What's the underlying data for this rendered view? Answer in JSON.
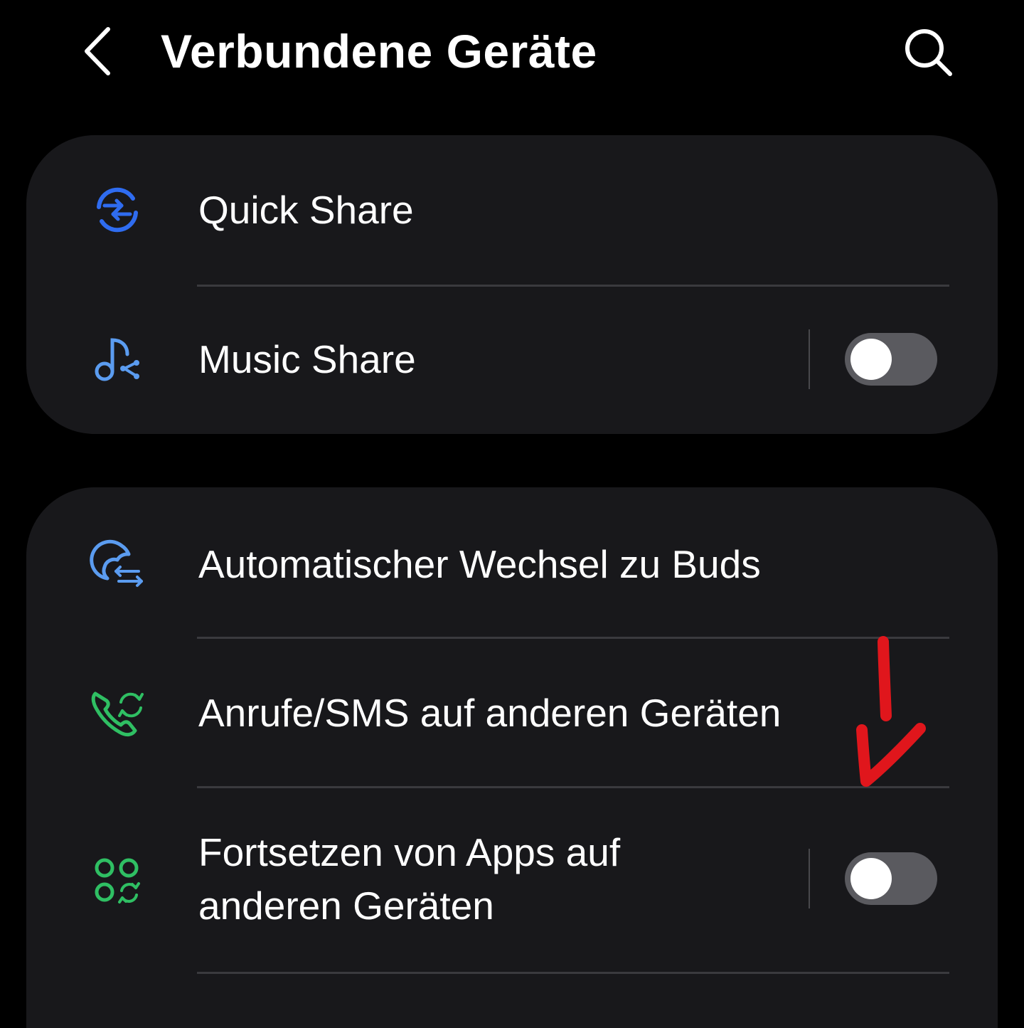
{
  "header": {
    "title": "Verbundene Geräte",
    "back_icon": "chevron-left-icon",
    "search_icon": "search-icon"
  },
  "colors": {
    "background": "#000000",
    "card": "#18181b",
    "text": "#ffffff",
    "divider": "#3a3a3e",
    "toggle_off_track": "#5a5a5f",
    "toggle_knob": "#ffffff",
    "icon_blue": "#2f6cf0",
    "icon_light_blue": "#5b9cf0",
    "icon_green": "#2fbf63",
    "annotation_red": "#e0161c"
  },
  "groups": [
    {
      "items": [
        {
          "label": "Quick Share",
          "icon": "quick-share-icon"
        },
        {
          "label": "Music Share",
          "icon": "music-share-icon",
          "toggle": {
            "on": false
          }
        }
      ]
    },
    {
      "items": [
        {
          "label": "Automatischer Wechsel zu Buds",
          "icon": "buds-switch-icon"
        },
        {
          "label": "Anrufe/SMS auf anderen Geräten",
          "icon": "call-sync-icon"
        },
        {
          "label_line1": "Fortsetzen von Apps auf",
          "label_line2": "anderen Geräten",
          "icon": "continue-apps-icon",
          "toggle": {
            "on": false
          }
        }
      ]
    }
  ],
  "annotation": {
    "type": "hand-drawn-arrow",
    "color": "red",
    "direction": "down"
  }
}
